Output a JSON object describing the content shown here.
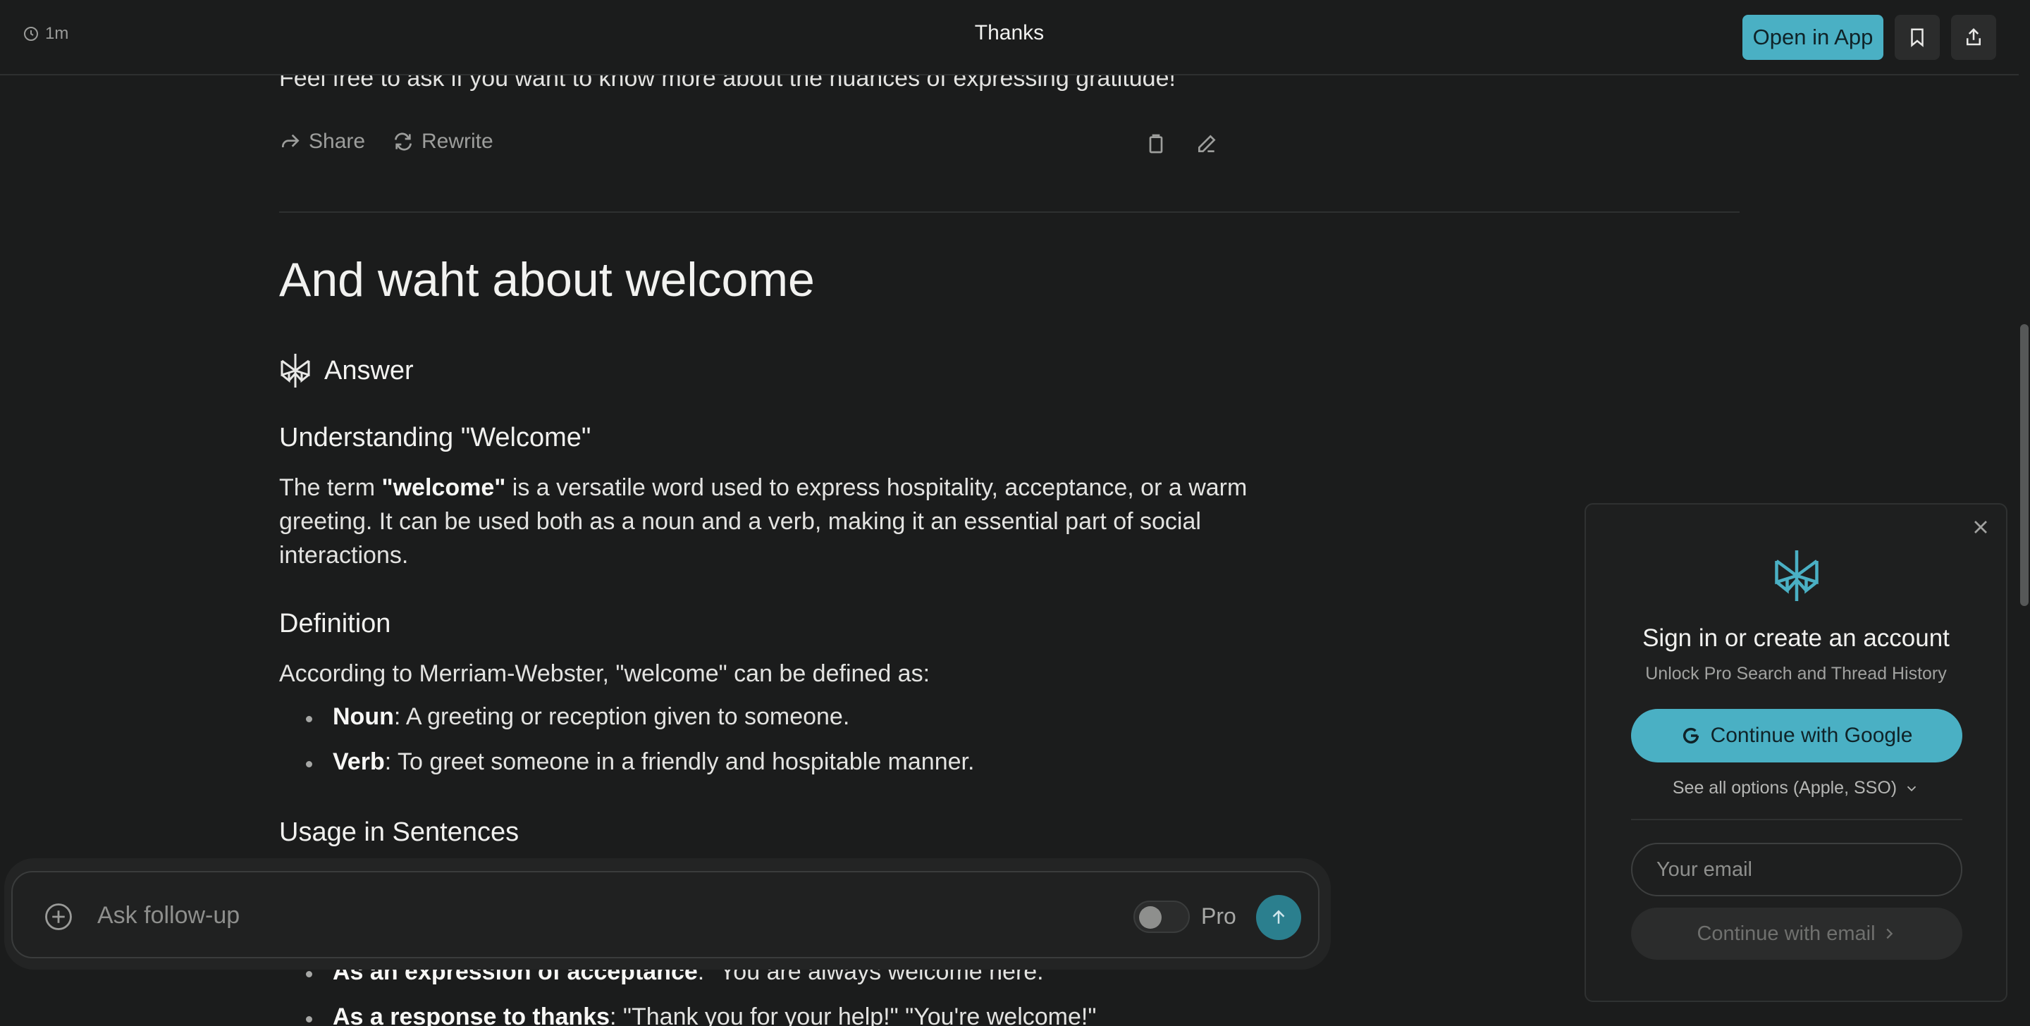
{
  "topbar": {
    "time": "1m",
    "title": "Thanks",
    "open_app_label": "Open in App",
    "bookmark_icon": "bookmark-icon",
    "share_icon": "share-icon"
  },
  "previous": {
    "last_line": "Feel free to ask if you want to know more about the nuances of expressing gratitude!",
    "share_label": "Share",
    "rewrite_label": "Rewrite"
  },
  "thread": {
    "question": "And waht about welcome",
    "answer_label": "Answer",
    "h_understanding": "Understanding \"Welcome\"",
    "p1_before": "The term ",
    "p1_bold": "\"welcome\"",
    "p1_after": " is a versatile word used to express hospitality, acceptance, or a warm greeting. It can be used both as a noun and a verb, making it an essential part of social interactions.",
    "h_definition": "Definition",
    "def_intro": "According to Merriam-Webster, \"welcome\" can be defined as:",
    "def_items": [
      {
        "term": "Noun",
        "text": ": A greeting or reception given to someone."
      },
      {
        "term": "Verb",
        "text": ": To greet someone in a friendly and hospitable manner."
      }
    ],
    "h_usage": "Usage in Sentences",
    "usage_items": [
      {
        "term": "As an expression of acceptance",
        "text": ": \"You are always welcome here.\""
      },
      {
        "term": "As a response to thanks",
        "text": ": \"Thank you for your help!\" \"You're welcome!\""
      }
    ]
  },
  "followup": {
    "placeholder": "Ask follow-up",
    "pro_label": "Pro",
    "pro_enabled": false
  },
  "signin": {
    "title": "Sign in or create an account",
    "subtitle": "Unlock Pro Search and Thread History",
    "google_label": "Continue with Google",
    "see_all_label": "See all options (Apple, SSO)",
    "email_placeholder": "Your email",
    "email_button_label": "Continue with email"
  },
  "colors": {
    "background": "#1b1c1c",
    "accent": "#4ab0c4",
    "send_button": "#2b7f8e"
  }
}
